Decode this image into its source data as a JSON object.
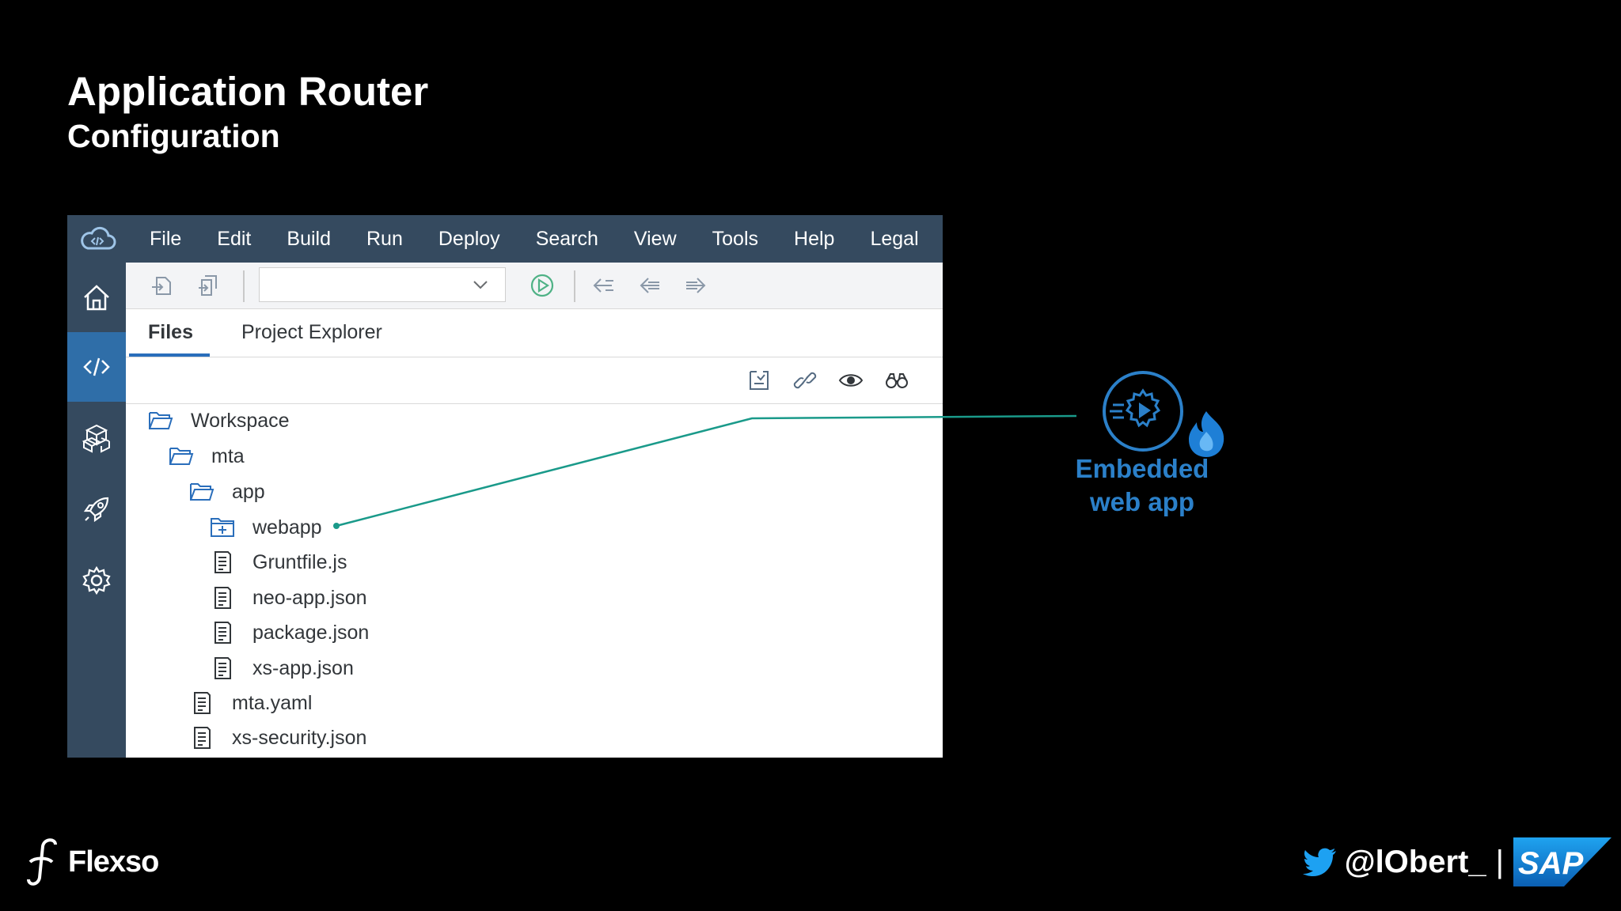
{
  "slide": {
    "title": "Application Router",
    "subtitle": "Configuration"
  },
  "ide": {
    "menu": [
      "File",
      "Edit",
      "Build",
      "Run",
      "Deploy",
      "Search",
      "View",
      "Tools",
      "Help",
      "Legal"
    ],
    "sidebar": [
      "home-icon",
      "code-icon",
      "cubes-icon",
      "rocket-icon",
      "gear-icon"
    ],
    "sidebar_active": "code-icon",
    "toolbar": {
      "run_config_value": "",
      "icons": [
        "import-icon",
        "export-icon",
        "run-icon",
        "back-list-icon",
        "arrow-left-icon",
        "arrow-right-icon"
      ]
    },
    "tabs": {
      "files": "Files",
      "project_explorer": "Project Explorer",
      "active": "Files"
    },
    "file_tools": [
      "collapse-all-icon",
      "link-with-editor-icon",
      "show-hidden-icon",
      "search-binoculars-icon"
    ],
    "tree": [
      {
        "label": "Workspace",
        "type": "folder-open",
        "level": 0
      },
      {
        "label": "mta",
        "type": "folder-open",
        "level": 1
      },
      {
        "label": "app",
        "type": "folder-open",
        "level": 2
      },
      {
        "label": "webapp",
        "type": "folder-module",
        "level": 3
      },
      {
        "label": "Gruntfile.js",
        "type": "file",
        "level": 3
      },
      {
        "label": "neo-app.json",
        "type": "file",
        "level": 3
      },
      {
        "label": "package.json",
        "type": "file",
        "level": 3
      },
      {
        "label": "xs-app.json",
        "type": "file",
        "level": 3
      },
      {
        "label": "mta.yaml",
        "type": "file",
        "level": 2
      },
      {
        "label": "xs-security.json",
        "type": "file",
        "level": 2
      }
    ]
  },
  "callout": {
    "line1": "Embedded",
    "line2": "web app",
    "points_to": "webapp",
    "color": "#2b80c9",
    "line_color": "#1a9a8a"
  },
  "footer": {
    "brand": "Flexso",
    "twitter_handle": "@lObert_",
    "separator": "|",
    "sap_logo_text": "SAP"
  },
  "colors": {
    "ide_nav": "#354a5f",
    "ide_active": "#2f6ea8",
    "accent_blue": "#2a6ebb",
    "icon_grey": "#556b82"
  }
}
